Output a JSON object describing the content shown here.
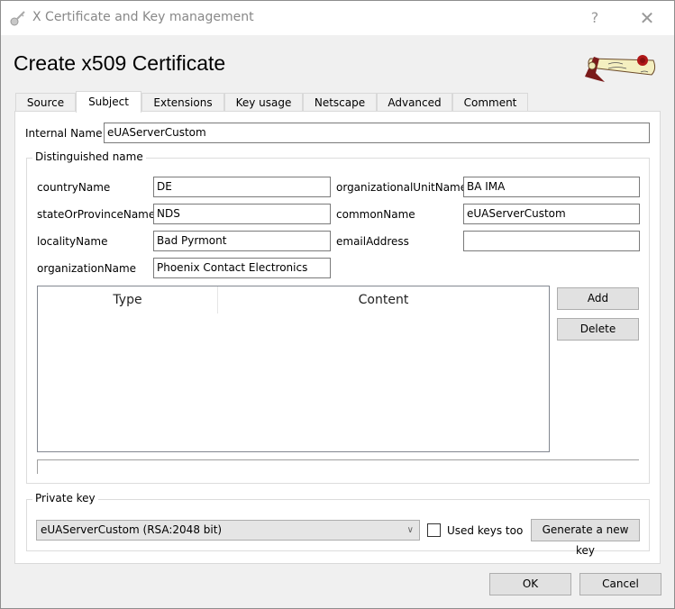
{
  "window": {
    "title": "X Certificate and Key management",
    "help_label": "?",
    "close_label": "✕"
  },
  "header": {
    "title": "Create x509 Certificate"
  },
  "tabs": [
    {
      "label": "Source",
      "active": false
    },
    {
      "label": "Subject",
      "active": true
    },
    {
      "label": "Extensions",
      "active": false
    },
    {
      "label": "Key usage",
      "active": false
    },
    {
      "label": "Netscape",
      "active": false
    },
    {
      "label": "Advanced",
      "active": false
    },
    {
      "label": "Comment",
      "active": false
    }
  ],
  "subject": {
    "internal_name_label": "Internal Name",
    "internal_name_value": "eUAServerCustom",
    "dn_group_title": "Distinguished name",
    "fields": {
      "countryName": {
        "label": "countryName",
        "value": "DE"
      },
      "stateOrProvinceName": {
        "label": "stateOrProvinceName",
        "value": "NDS"
      },
      "localityName": {
        "label": "localityName",
        "value": "Bad Pyrmont"
      },
      "organizationName": {
        "label": "organizationName",
        "value": "Phoenix Contact Electronics"
      },
      "organizationalUnitName": {
        "label": "organizationalUnitName",
        "value": "BA IMA"
      },
      "commonName": {
        "label": "commonName",
        "value": "eUAServerCustom"
      },
      "emailAddress": {
        "label": "emailAddress",
        "value": ""
      }
    },
    "table": {
      "columns": [
        "Type",
        "Content"
      ],
      "rows": []
    },
    "add_label": "Add",
    "delete_label": "Delete"
  },
  "private_key": {
    "group_title": "Private key",
    "selected": "eUAServerCustom (RSA:2048 bit)",
    "used_keys_label": "Used keys too",
    "used_keys_checked": false,
    "generate_label": "Generate a new key"
  },
  "footer": {
    "ok_label": "OK",
    "cancel_label": "Cancel"
  }
}
